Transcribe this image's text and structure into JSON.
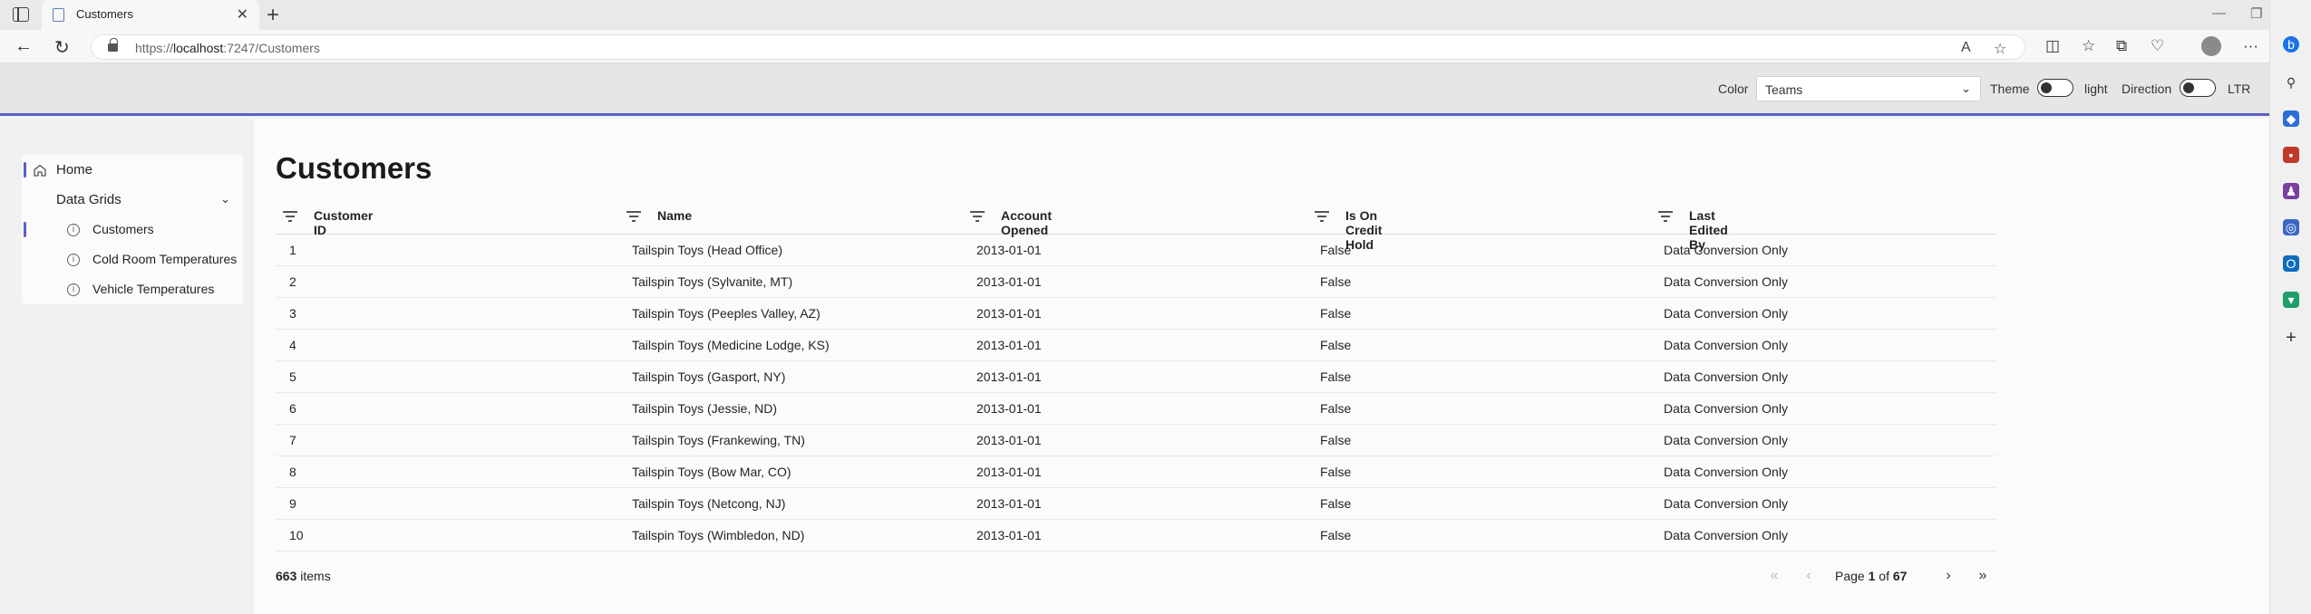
{
  "browser": {
    "tab_title": "Customers",
    "url_prefix": "https://",
    "url_host": "localhost",
    "url_rest": ":7247/Customers"
  },
  "header": {
    "color_label": "Color",
    "color_value": "Teams",
    "theme_label": "Theme",
    "theme_value": "light",
    "direction_label": "Direction",
    "direction_value": "LTR"
  },
  "nav": {
    "home": "Home",
    "data_grids": "Data Grids",
    "items": [
      {
        "label": "Customers",
        "selected": true
      },
      {
        "label": "Cold Room Temperatures",
        "selected": false
      },
      {
        "label": "Vehicle Temperatures",
        "selected": false
      }
    ]
  },
  "page": {
    "title": "Customers"
  },
  "grid": {
    "columns": [
      "Customer ID",
      "Name",
      "Account Opened",
      "Is On Credit Hold",
      "Last Edited By"
    ],
    "rows": [
      [
        "1",
        "Tailspin Toys (Head Office)",
        "2013-01-01",
        "False",
        "Data Conversion Only"
      ],
      [
        "2",
        "Tailspin Toys (Sylvanite, MT)",
        "2013-01-01",
        "False",
        "Data Conversion Only"
      ],
      [
        "3",
        "Tailspin Toys (Peeples Valley, AZ)",
        "2013-01-01",
        "False",
        "Data Conversion Only"
      ],
      [
        "4",
        "Tailspin Toys (Medicine Lodge, KS)",
        "2013-01-01",
        "False",
        "Data Conversion Only"
      ],
      [
        "5",
        "Tailspin Toys (Gasport, NY)",
        "2013-01-01",
        "False",
        "Data Conversion Only"
      ],
      [
        "6",
        "Tailspin Toys (Jessie, ND)",
        "2013-01-01",
        "False",
        "Data Conversion Only"
      ],
      [
        "7",
        "Tailspin Toys (Frankewing, TN)",
        "2013-01-01",
        "False",
        "Data Conversion Only"
      ],
      [
        "8",
        "Tailspin Toys (Bow Mar, CO)",
        "2013-01-01",
        "False",
        "Data Conversion Only"
      ],
      [
        "9",
        "Tailspin Toys (Netcong, NJ)",
        "2013-01-01",
        "False",
        "Data Conversion Only"
      ],
      [
        "10",
        "Tailspin Toys (Wimbledon, ND)",
        "2013-01-01",
        "False",
        "Data Conversion Only"
      ]
    ],
    "total_count": "663",
    "items_label": "items",
    "page_label": "Page",
    "current_page": "1",
    "of_label": "of",
    "total_pages": "67"
  },
  "colors": {
    "accent": "#5b5fc7"
  }
}
